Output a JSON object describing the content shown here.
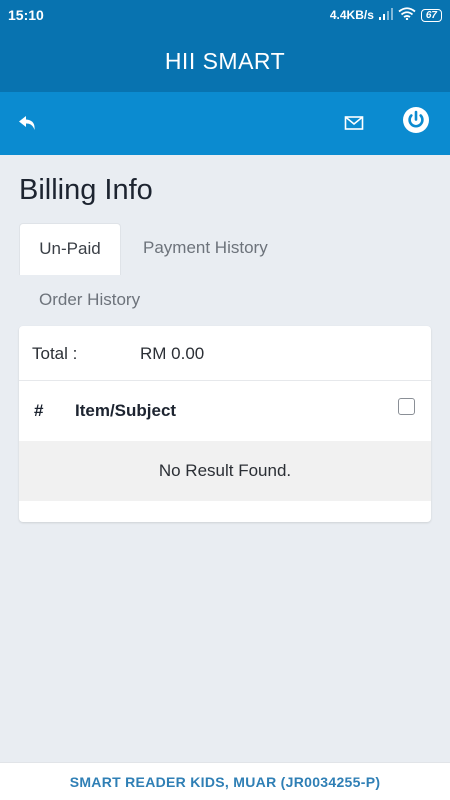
{
  "status_bar": {
    "time": "15:10",
    "network_speed": "4.4KB/s",
    "battery": "67"
  },
  "header": {
    "title": "HII SMART"
  },
  "toolbar": {
    "back_icon": "undo-arrow-icon",
    "mail_icon": "envelope-icon",
    "power_icon": "power-icon"
  },
  "page": {
    "title": "Billing Info"
  },
  "tabs": [
    {
      "label": "Un-Paid",
      "active": true
    },
    {
      "label": "Payment History",
      "active": false
    },
    {
      "label": "Order History",
      "active": false
    }
  ],
  "billing": {
    "total_label": "Total :",
    "total_value": "RM 0.00",
    "columns": [
      "#",
      "Item/Subject"
    ],
    "empty_message": "No Result Found."
  },
  "footer": {
    "text": "SMART READER KIDS, MUAR (JR0034255-P)"
  },
  "colors": {
    "primary": "#0873b0",
    "toolbar": "#0b8bd0",
    "background": "#e9edf2",
    "footer_text": "#2f7fb5"
  }
}
